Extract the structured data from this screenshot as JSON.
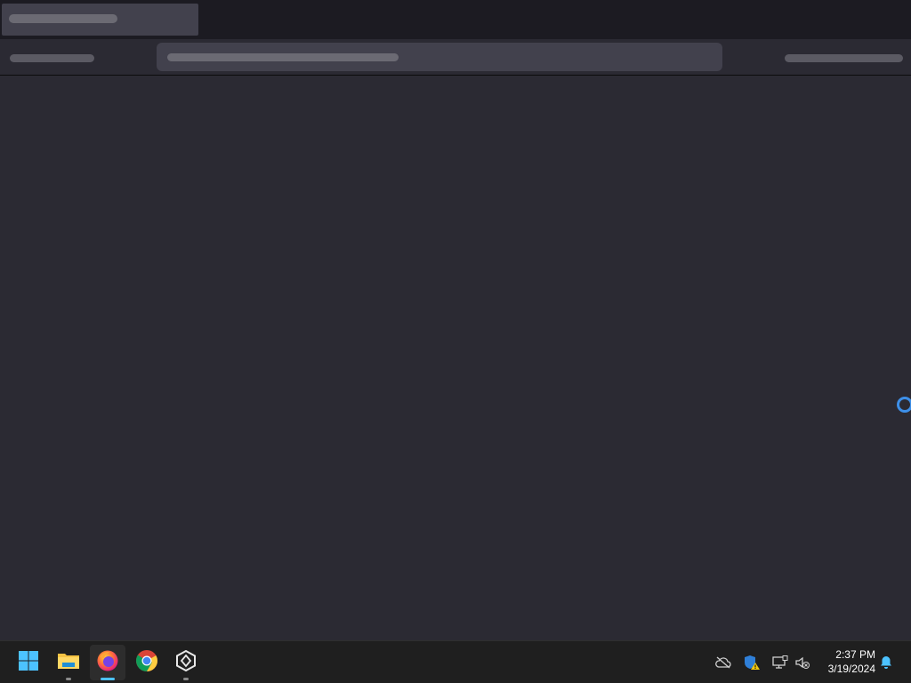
{
  "taskbar": {
    "apps": [
      {
        "name": "start-icon"
      },
      {
        "name": "file-explorer-icon"
      },
      {
        "name": "firefox-icon"
      },
      {
        "name": "chrome-icon"
      },
      {
        "name": "unity-icon"
      }
    ],
    "tray": {
      "icons": [
        "cloud-off-icon",
        "security-warning-icon",
        "network-icon",
        "volume-muted-icon",
        "notification-bell-icon"
      ]
    },
    "clock": {
      "time": "2:37 PM",
      "date": "3/19/2024"
    }
  },
  "colors": {
    "accent": "#4cc2ff",
    "background": "#2b2a33",
    "spinner": "#3d8fe8"
  }
}
